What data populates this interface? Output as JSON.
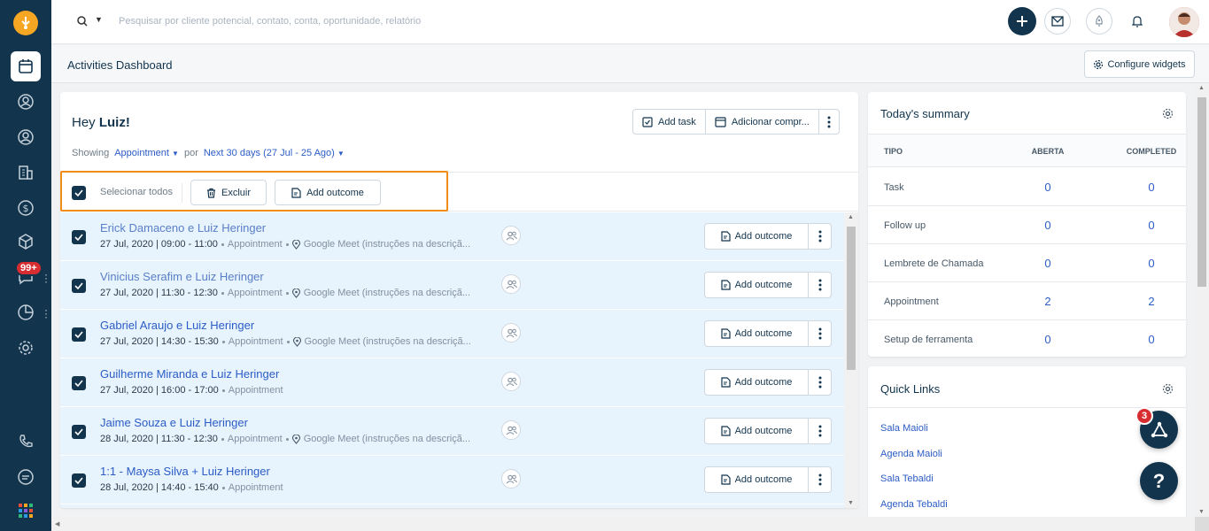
{
  "search": {
    "placeholder": "Pesquisar por cliente potencial, contato, conta, oportunidade, relatório"
  },
  "sidebar": {
    "badge": "99+"
  },
  "header": {
    "title": "Activities Dashboard",
    "configure_label": "Configure widgets"
  },
  "main": {
    "greeting_prefix": "Hey ",
    "greeting_name": "Luiz!",
    "add_task_label": "Add task",
    "add_appt_label": "Adicionar compr...",
    "showing_label": "Showing",
    "filter_type": "Appointment",
    "por_label": "por",
    "filter_range": "Next 30 days (27 Jul - 25 Ago)",
    "select_all_label": "Selecionar todos",
    "delete_label": "Excluir",
    "add_outcome_label": "Add outcome",
    "rows": [
      {
        "title": "Erick Damaceno e Luiz Heringer",
        "datetime": "27 Jul, 2020 | 09:00 - 11:00",
        "type": "Appointment",
        "location": "Google Meet (instruções na descriçã...",
        "outcome": "Add outcome"
      },
      {
        "title": "Vinicius Serafim e Luiz Heringer",
        "datetime": "27 Jul, 2020 | 11:30 - 12:30",
        "type": "Appointment",
        "location": "Google Meet (instruções na descriçã...",
        "outcome": "Add outcome"
      },
      {
        "title": "Gabriel Araujo e Luiz Heringer",
        "datetime": "27 Jul, 2020 | 14:30 - 15:30",
        "type": "Appointment",
        "location": "Google Meet (instruções na descriçã...",
        "outcome": "Add outcome"
      },
      {
        "title": "Guilherme Miranda e Luiz Heringer",
        "datetime": "27 Jul, 2020 | 16:00 - 17:00",
        "type": "Appointment",
        "location": "",
        "outcome": "Add outcome"
      },
      {
        "title": "Jaime Souza e Luiz Heringer",
        "datetime": "28 Jul, 2020 | 11:30 - 12:30",
        "type": "Appointment",
        "location": "Google Meet (instruções na descriçã...",
        "outcome": "Add outcome"
      },
      {
        "title": "1:1 - Maysa Silva + Luiz Heringer",
        "datetime": "28 Jul, 2020 | 14:40 - 15:40",
        "type": "Appointment",
        "location": "",
        "outcome": "Add outcome"
      }
    ]
  },
  "summary": {
    "title": "Today's summary",
    "col_tipo": "TIPO",
    "col_aberta": "ABERTA",
    "col_completed": "COMPLETED",
    "rows": [
      {
        "tipo": "Task",
        "aberta": "0",
        "completed": "0"
      },
      {
        "tipo": "Follow up",
        "aberta": "0",
        "completed": "0"
      },
      {
        "tipo": "Lembrete de Chamada",
        "aberta": "0",
        "completed": "0"
      },
      {
        "tipo": "Appointment",
        "aberta": "2",
        "completed": "2"
      },
      {
        "tipo": "Setup de ferramenta",
        "aberta": "0",
        "completed": "0"
      }
    ]
  },
  "quick_links": {
    "title": "Quick Links",
    "links": [
      "Sala Maioli",
      "Agenda Maioli",
      "Sala Tebaldi",
      "Agenda Tebaldi"
    ]
  },
  "fab": {
    "badge": "3",
    "help": "?"
  }
}
